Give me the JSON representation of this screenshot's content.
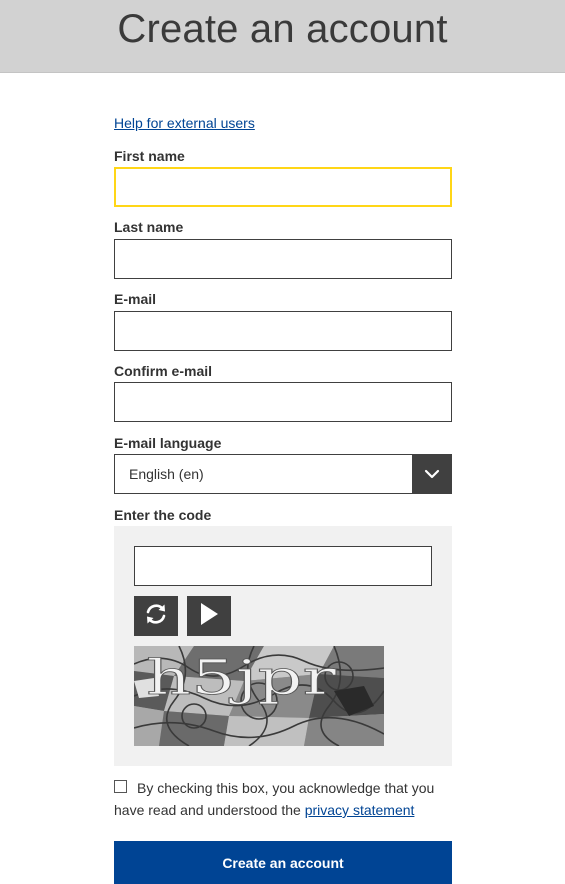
{
  "header": {
    "title": "Create an account"
  },
  "help_link": "Help for external users",
  "fields": {
    "first_name": {
      "label": "First name",
      "value": ""
    },
    "last_name": {
      "label": "Last name",
      "value": ""
    },
    "email": {
      "label": "E-mail",
      "value": ""
    },
    "confirm_email": {
      "label": "Confirm e-mail",
      "value": ""
    },
    "email_language": {
      "label": "E-mail language",
      "selected": "English (en)"
    }
  },
  "captcha": {
    "label": "Enter the code",
    "value": "",
    "refresh_icon": "refresh-icon",
    "play_icon": "play-icon",
    "code_text": "h5jpr"
  },
  "consent": {
    "text": "By checking this box, you acknowledge that you have read and understood the ",
    "link": "privacy statement",
    "checked": false
  },
  "submit_label": "Create an account",
  "colors": {
    "header_bg": "#d2d2d2",
    "link": "#004494",
    "focus": "#ffd617",
    "button": "#004494",
    "dark_control": "#404040"
  }
}
